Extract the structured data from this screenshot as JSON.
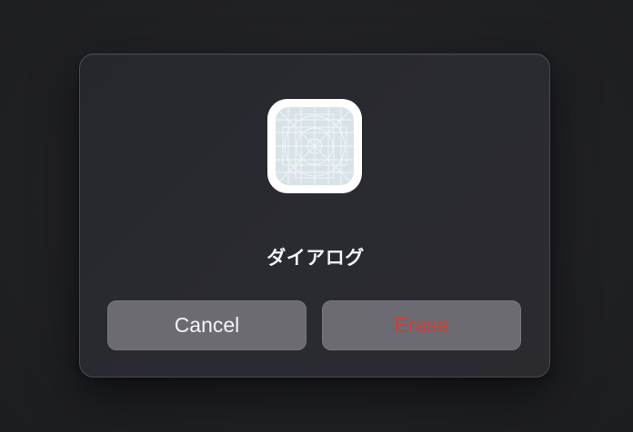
{
  "dialog": {
    "icon": "app-icon-template",
    "title": "ダイアログ",
    "buttons": {
      "cancel_label": "Cancel",
      "erase_label": "Erase"
    }
  },
  "colors": {
    "background": "#1f2023",
    "dialog_background": "#27282e",
    "button_background": "#6b6b71",
    "cancel_text": "#f5f5f7",
    "erase_text": "#d33d35",
    "icon_fill": "#d8e3e8"
  }
}
